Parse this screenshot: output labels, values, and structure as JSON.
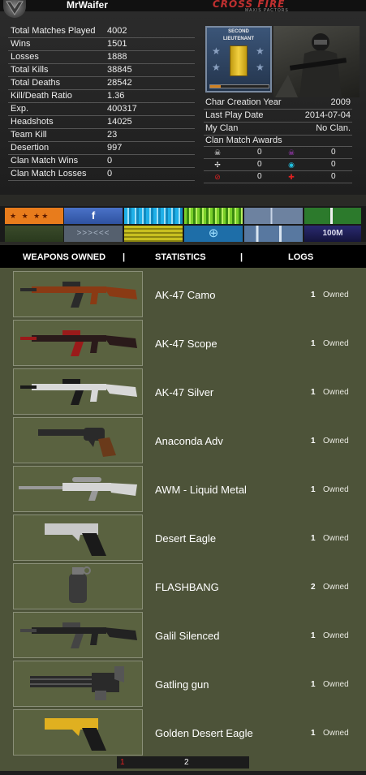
{
  "profile": {
    "username": "MrWaifer",
    "logo": "CROSS FIRE",
    "logo_sub": "MAXIS PACTORS"
  },
  "stats": [
    {
      "label": "Total Matches Played",
      "value": "4002"
    },
    {
      "label": "Wins",
      "value": "1501"
    },
    {
      "label": "Losses",
      "value": "1888"
    },
    {
      "label": "Total Kills",
      "value": "38845"
    },
    {
      "label": "Total Deaths",
      "value": "28542"
    },
    {
      "label": "Kill/Death Ratio",
      "value": "1.36"
    },
    {
      "label": "Exp.",
      "value": "400317"
    },
    {
      "label": "Headshots",
      "value": "14025"
    },
    {
      "label": "Team Kill",
      "value": "23"
    },
    {
      "label": "Desertion",
      "value": "997"
    },
    {
      "label": "Clan Match Wins",
      "value": "0"
    },
    {
      "label": "Clan Match Losses",
      "value": "0"
    }
  ],
  "rank": {
    "title_line1": "SECOND",
    "title_line2": "LIEUTENANT"
  },
  "info": [
    {
      "label": "Char Creation Year",
      "value": "2009"
    },
    {
      "label": "Last Play Date",
      "value": "2014-07-04"
    },
    {
      "label": "My Clan",
      "value": "No Clan."
    }
  ],
  "awards": {
    "title": "Clan Match Awards",
    "rows": [
      [
        {
          "icon": "skull-icon",
          "glyph": "☠",
          "color": "#ffffff",
          "value": "0"
        },
        {
          "icon": "skull-purple-icon",
          "glyph": "☠",
          "color": "#c040e0",
          "value": "0"
        }
      ],
      [
        {
          "icon": "crosshair-icon",
          "glyph": "✢",
          "color": "#ffffff",
          "value": "0"
        },
        {
          "icon": "target-icon",
          "glyph": "◉",
          "color": "#20c0e0",
          "value": "0"
        }
      ],
      [
        {
          "icon": "no-icon",
          "glyph": "⊘",
          "color": "#e02020",
          "value": "0"
        },
        {
          "icon": "medic-cross-icon",
          "glyph": "✚",
          "color": "#e02020",
          "value": "0"
        }
      ]
    ]
  },
  "badges": {
    "stars": "★ ★ ★★",
    "facebook": "f",
    "arrows": ">>><<<",
    "crosshair": "⊕",
    "amount": "100M"
  },
  "nav": {
    "weapons": "WEAPONS OWNED",
    "statistics": "STATISTICS",
    "logs": "LOGS",
    "sep": "|"
  },
  "weapons": [
    {
      "name": "AK-47 Camo",
      "count": "1",
      "owned": "Owned",
      "kind": "rifle",
      "color": "#8a3a14",
      "accent": "#2a2a2a"
    },
    {
      "name": "AK-47 Scope",
      "count": "1",
      "owned": "Owned",
      "kind": "rifle",
      "color": "#2a1a1a",
      "accent": "#9a1a1a"
    },
    {
      "name": "AK-47 Silver",
      "count": "1",
      "owned": "Owned",
      "kind": "rifle",
      "color": "#d8d8d8",
      "accent": "#1a1a1a"
    },
    {
      "name": "Anaconda Adv",
      "count": "1",
      "owned": "Owned",
      "kind": "revolver",
      "color": "#2a2a2a",
      "accent": "#6a3a1a"
    },
    {
      "name": "AWM - Liquid Metal",
      "count": "1",
      "owned": "Owned",
      "kind": "sniper",
      "color": "#d4d4d4",
      "accent": "#999999"
    },
    {
      "name": "Desert Eagle",
      "count": "1",
      "owned": "Owned",
      "kind": "pistol",
      "color": "#c8c8c8",
      "accent": "#1a1a1a"
    },
    {
      "name": "FLASHBANG",
      "count": "2",
      "owned": "Owned",
      "kind": "grenade",
      "color": "#3a3a3a",
      "accent": "#777777"
    },
    {
      "name": "Galil Silenced",
      "count": "1",
      "owned": "Owned",
      "kind": "rifle",
      "color": "#222222",
      "accent": "#444444"
    },
    {
      "name": "Gatling gun",
      "count": "1",
      "owned": "Owned",
      "kind": "gatling",
      "color": "#2a2a2a",
      "accent": "#555555"
    },
    {
      "name": "Golden Desert Eagle",
      "count": "1",
      "owned": "Owned",
      "kind": "pistol",
      "color": "#e0b020",
      "accent": "#1a1a1a"
    }
  ],
  "pager": {
    "page1": "1",
    "page2": "2"
  }
}
